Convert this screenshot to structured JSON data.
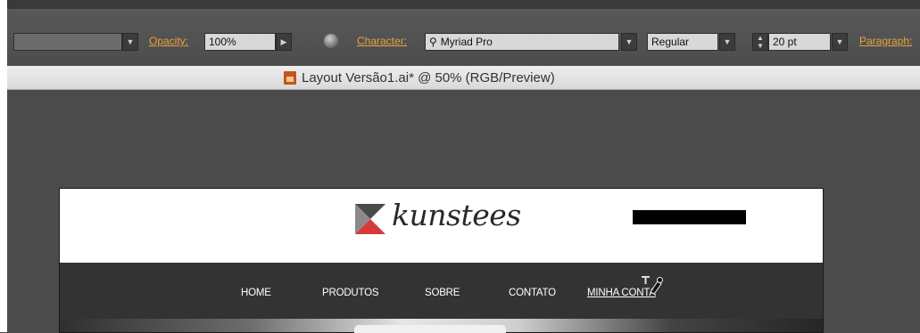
{
  "control_bar": {
    "opacity_label": "Opacity:",
    "opacity_value": "100%",
    "character_label": "Character:",
    "font_family": "Myriad Pro",
    "font_style": "Regular",
    "font_size": "20 pt",
    "paragraph_label": "Paragraph:"
  },
  "document": {
    "title": "Layout Versão1.ai* @ 50% (RGB/Preview)"
  },
  "site": {
    "logo_text": "kunstees",
    "nav": [
      "HOME",
      "PRODUTOS",
      "SOBRE",
      "CONTATO",
      "MINHA CONTA"
    ]
  },
  "colors": {
    "accent_label": "#e8a23a",
    "nav_background": "#333333",
    "logo_red": "#d63a3a"
  }
}
